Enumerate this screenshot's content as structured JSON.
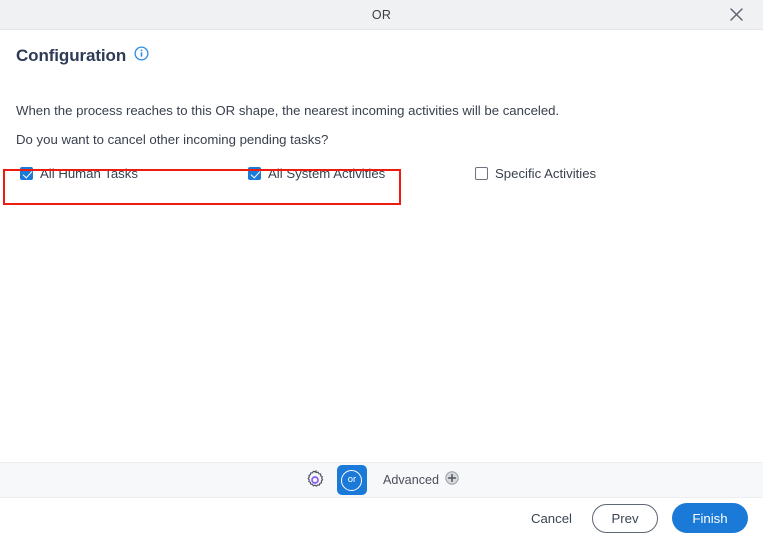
{
  "window": {
    "title": "OR",
    "close_icon": "close-icon"
  },
  "header": {
    "heading": "Configuration",
    "info_icon": "info-circle-icon"
  },
  "body": {
    "paragraph_1": "When the process reaches to this OR shape, the nearest incoming activities will be canceled.",
    "paragraph_2": "Do you want to cancel other incoming pending tasks?"
  },
  "checkboxes": [
    {
      "label": "All Human Tasks",
      "checked": true
    },
    {
      "label": "All System Activities",
      "checked": true
    },
    {
      "label": "Specific Activities",
      "checked": false
    }
  ],
  "annotation": {
    "highlight_color": "#ee1b11"
  },
  "toolbar": {
    "gear_icon": "gear-icon",
    "shape_badge_label": "or",
    "advanced_label": "Advanced",
    "advanced_add_icon": "plus-circle-icon"
  },
  "buttons": {
    "cancel": "Cancel",
    "prev": "Prev",
    "finish": "Finish"
  },
  "colors": {
    "accent_blue": "#1b79d8",
    "titlebar_bg": "#f0f1f3",
    "toolbar_bg": "#f7f8fa",
    "gear_accent": "#8b5cf6"
  }
}
